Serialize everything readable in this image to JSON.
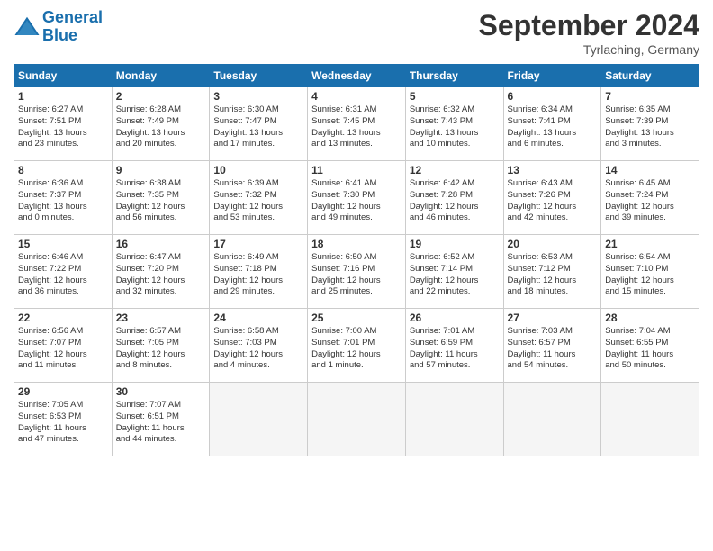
{
  "header": {
    "logo_line1": "General",
    "logo_line2": "Blue",
    "month": "September 2024",
    "location": "Tyrlaching, Germany"
  },
  "weekdays": [
    "Sunday",
    "Monday",
    "Tuesday",
    "Wednesday",
    "Thursday",
    "Friday",
    "Saturday"
  ],
  "weeks": [
    [
      {
        "day": "1",
        "info": "Sunrise: 6:27 AM\nSunset: 7:51 PM\nDaylight: 13 hours\nand 23 minutes."
      },
      {
        "day": "2",
        "info": "Sunrise: 6:28 AM\nSunset: 7:49 PM\nDaylight: 13 hours\nand 20 minutes."
      },
      {
        "day": "3",
        "info": "Sunrise: 6:30 AM\nSunset: 7:47 PM\nDaylight: 13 hours\nand 17 minutes."
      },
      {
        "day": "4",
        "info": "Sunrise: 6:31 AM\nSunset: 7:45 PM\nDaylight: 13 hours\nand 13 minutes."
      },
      {
        "day": "5",
        "info": "Sunrise: 6:32 AM\nSunset: 7:43 PM\nDaylight: 13 hours\nand 10 minutes."
      },
      {
        "day": "6",
        "info": "Sunrise: 6:34 AM\nSunset: 7:41 PM\nDaylight: 13 hours\nand 6 minutes."
      },
      {
        "day": "7",
        "info": "Sunrise: 6:35 AM\nSunset: 7:39 PM\nDaylight: 13 hours\nand 3 minutes."
      }
    ],
    [
      {
        "day": "8",
        "info": "Sunrise: 6:36 AM\nSunset: 7:37 PM\nDaylight: 13 hours\nand 0 minutes."
      },
      {
        "day": "9",
        "info": "Sunrise: 6:38 AM\nSunset: 7:35 PM\nDaylight: 12 hours\nand 56 minutes."
      },
      {
        "day": "10",
        "info": "Sunrise: 6:39 AM\nSunset: 7:32 PM\nDaylight: 12 hours\nand 53 minutes."
      },
      {
        "day": "11",
        "info": "Sunrise: 6:41 AM\nSunset: 7:30 PM\nDaylight: 12 hours\nand 49 minutes."
      },
      {
        "day": "12",
        "info": "Sunrise: 6:42 AM\nSunset: 7:28 PM\nDaylight: 12 hours\nand 46 minutes."
      },
      {
        "day": "13",
        "info": "Sunrise: 6:43 AM\nSunset: 7:26 PM\nDaylight: 12 hours\nand 42 minutes."
      },
      {
        "day": "14",
        "info": "Sunrise: 6:45 AM\nSunset: 7:24 PM\nDaylight: 12 hours\nand 39 minutes."
      }
    ],
    [
      {
        "day": "15",
        "info": "Sunrise: 6:46 AM\nSunset: 7:22 PM\nDaylight: 12 hours\nand 36 minutes."
      },
      {
        "day": "16",
        "info": "Sunrise: 6:47 AM\nSunset: 7:20 PM\nDaylight: 12 hours\nand 32 minutes."
      },
      {
        "day": "17",
        "info": "Sunrise: 6:49 AM\nSunset: 7:18 PM\nDaylight: 12 hours\nand 29 minutes."
      },
      {
        "day": "18",
        "info": "Sunrise: 6:50 AM\nSunset: 7:16 PM\nDaylight: 12 hours\nand 25 minutes."
      },
      {
        "day": "19",
        "info": "Sunrise: 6:52 AM\nSunset: 7:14 PM\nDaylight: 12 hours\nand 22 minutes."
      },
      {
        "day": "20",
        "info": "Sunrise: 6:53 AM\nSunset: 7:12 PM\nDaylight: 12 hours\nand 18 minutes."
      },
      {
        "day": "21",
        "info": "Sunrise: 6:54 AM\nSunset: 7:10 PM\nDaylight: 12 hours\nand 15 minutes."
      }
    ],
    [
      {
        "day": "22",
        "info": "Sunrise: 6:56 AM\nSunset: 7:07 PM\nDaylight: 12 hours\nand 11 minutes."
      },
      {
        "day": "23",
        "info": "Sunrise: 6:57 AM\nSunset: 7:05 PM\nDaylight: 12 hours\nand 8 minutes."
      },
      {
        "day": "24",
        "info": "Sunrise: 6:58 AM\nSunset: 7:03 PM\nDaylight: 12 hours\nand 4 minutes."
      },
      {
        "day": "25",
        "info": "Sunrise: 7:00 AM\nSunset: 7:01 PM\nDaylight: 12 hours\nand 1 minute."
      },
      {
        "day": "26",
        "info": "Sunrise: 7:01 AM\nSunset: 6:59 PM\nDaylight: 11 hours\nand 57 minutes."
      },
      {
        "day": "27",
        "info": "Sunrise: 7:03 AM\nSunset: 6:57 PM\nDaylight: 11 hours\nand 54 minutes."
      },
      {
        "day": "28",
        "info": "Sunrise: 7:04 AM\nSunset: 6:55 PM\nDaylight: 11 hours\nand 50 minutes."
      }
    ],
    [
      {
        "day": "29",
        "info": "Sunrise: 7:05 AM\nSunset: 6:53 PM\nDaylight: 11 hours\nand 47 minutes."
      },
      {
        "day": "30",
        "info": "Sunrise: 7:07 AM\nSunset: 6:51 PM\nDaylight: 11 hours\nand 44 minutes."
      },
      {
        "day": "",
        "info": ""
      },
      {
        "day": "",
        "info": ""
      },
      {
        "day": "",
        "info": ""
      },
      {
        "day": "",
        "info": ""
      },
      {
        "day": "",
        "info": ""
      }
    ]
  ]
}
